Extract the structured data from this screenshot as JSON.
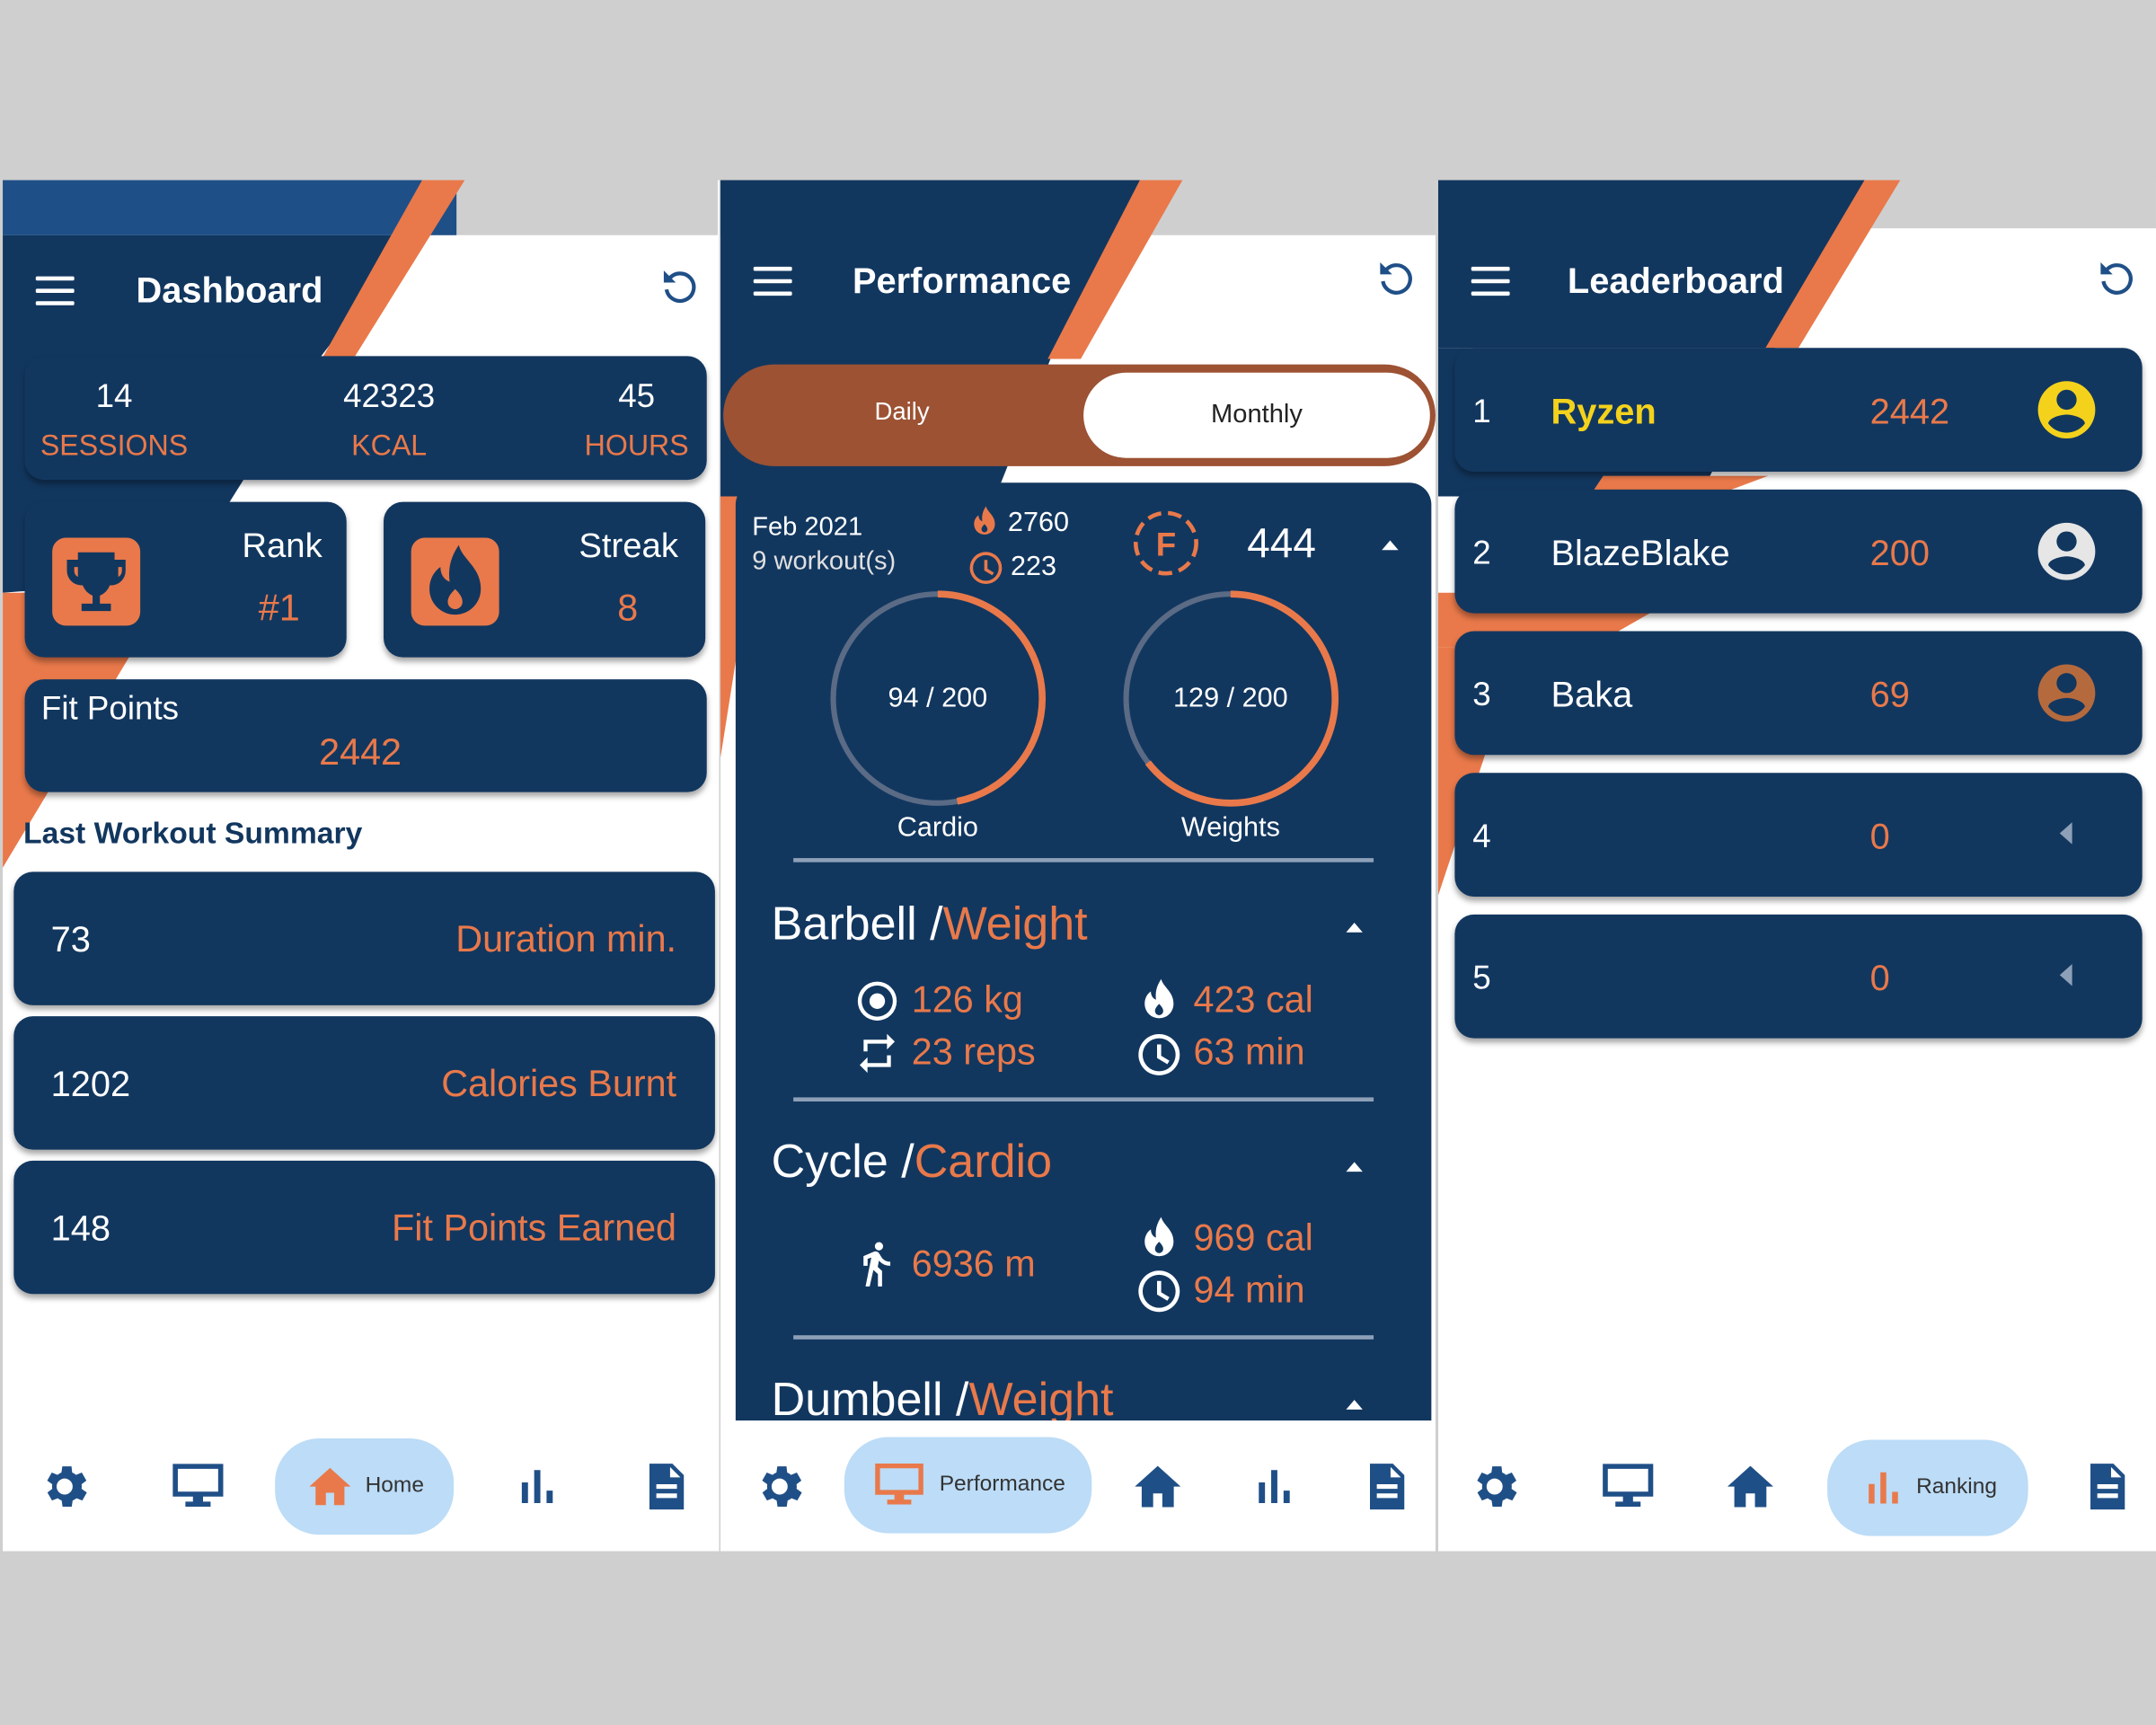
{
  "colors": {
    "navy": "#12375f",
    "bar_blue": "#1f4f87",
    "orange": "#e9794a",
    "gold": "#f4d21c",
    "pill": "#bcdcf7"
  },
  "dashboard": {
    "title": "Dashboard",
    "stats": [
      {
        "value": "14",
        "label": "SESSIONS"
      },
      {
        "value": "42323",
        "label": "KCAL"
      },
      {
        "value": "45",
        "label": "HOURS"
      }
    ],
    "rank": {
      "label": "Rank",
      "value": "#1"
    },
    "streak": {
      "label": "Streak",
      "value": "8"
    },
    "fit_points": {
      "label": "Fit Points",
      "value": "2442"
    },
    "summary_heading": "Last Workout Summary",
    "summary": [
      {
        "value": "73",
        "label": "Duration min."
      },
      {
        "value": "1202",
        "label": "Calories Burnt"
      },
      {
        "value": "148",
        "label": "Fit Points Earned"
      }
    ],
    "nav_active_label": "Home"
  },
  "performance": {
    "title": "Performance",
    "tabs": {
      "daily": "Daily",
      "monthly": "Monthly",
      "selected": "Monthly"
    },
    "month": "Feb 2021",
    "workouts": "9 workout(s)",
    "cal_total": "2760",
    "time_total": "223",
    "fp_total": "444",
    "cardio_ring": {
      "text": "94 / 200",
      "label": "Cardio",
      "progress": 0.47
    },
    "weights_ring": {
      "text": "129 / 200",
      "label": "Weights",
      "progress": 0.645
    },
    "exercises": [
      {
        "name": "Barbell /",
        "type": "Weight",
        "weight": "126 kg",
        "reps": "23 reps",
        "cal": "423 cal",
        "time": "63 min"
      },
      {
        "name": "Cycle /",
        "type": "Cardio",
        "distance": "6936 m",
        "cal": "969 cal",
        "time": "94 min"
      },
      {
        "name": "Dumbell /",
        "type": "Weight"
      }
    ],
    "nav_active_label": "Performance"
  },
  "leaderboard": {
    "title": "Leaderboard",
    "rows": [
      {
        "rank": "1",
        "name": "Ryzen",
        "points": "2442",
        "avatar_color": "#f4d21c"
      },
      {
        "rank": "2",
        "name": "BlazeBlake",
        "points": "200",
        "avatar_color": "#e6e6e6"
      },
      {
        "rank": "3",
        "name": "Baka",
        "points": "69",
        "avatar_color": "#b56a3e"
      },
      {
        "rank": "4",
        "name": "",
        "points": "0"
      },
      {
        "rank": "5",
        "name": "",
        "points": "0"
      }
    ],
    "nav_active_label": "Ranking"
  }
}
